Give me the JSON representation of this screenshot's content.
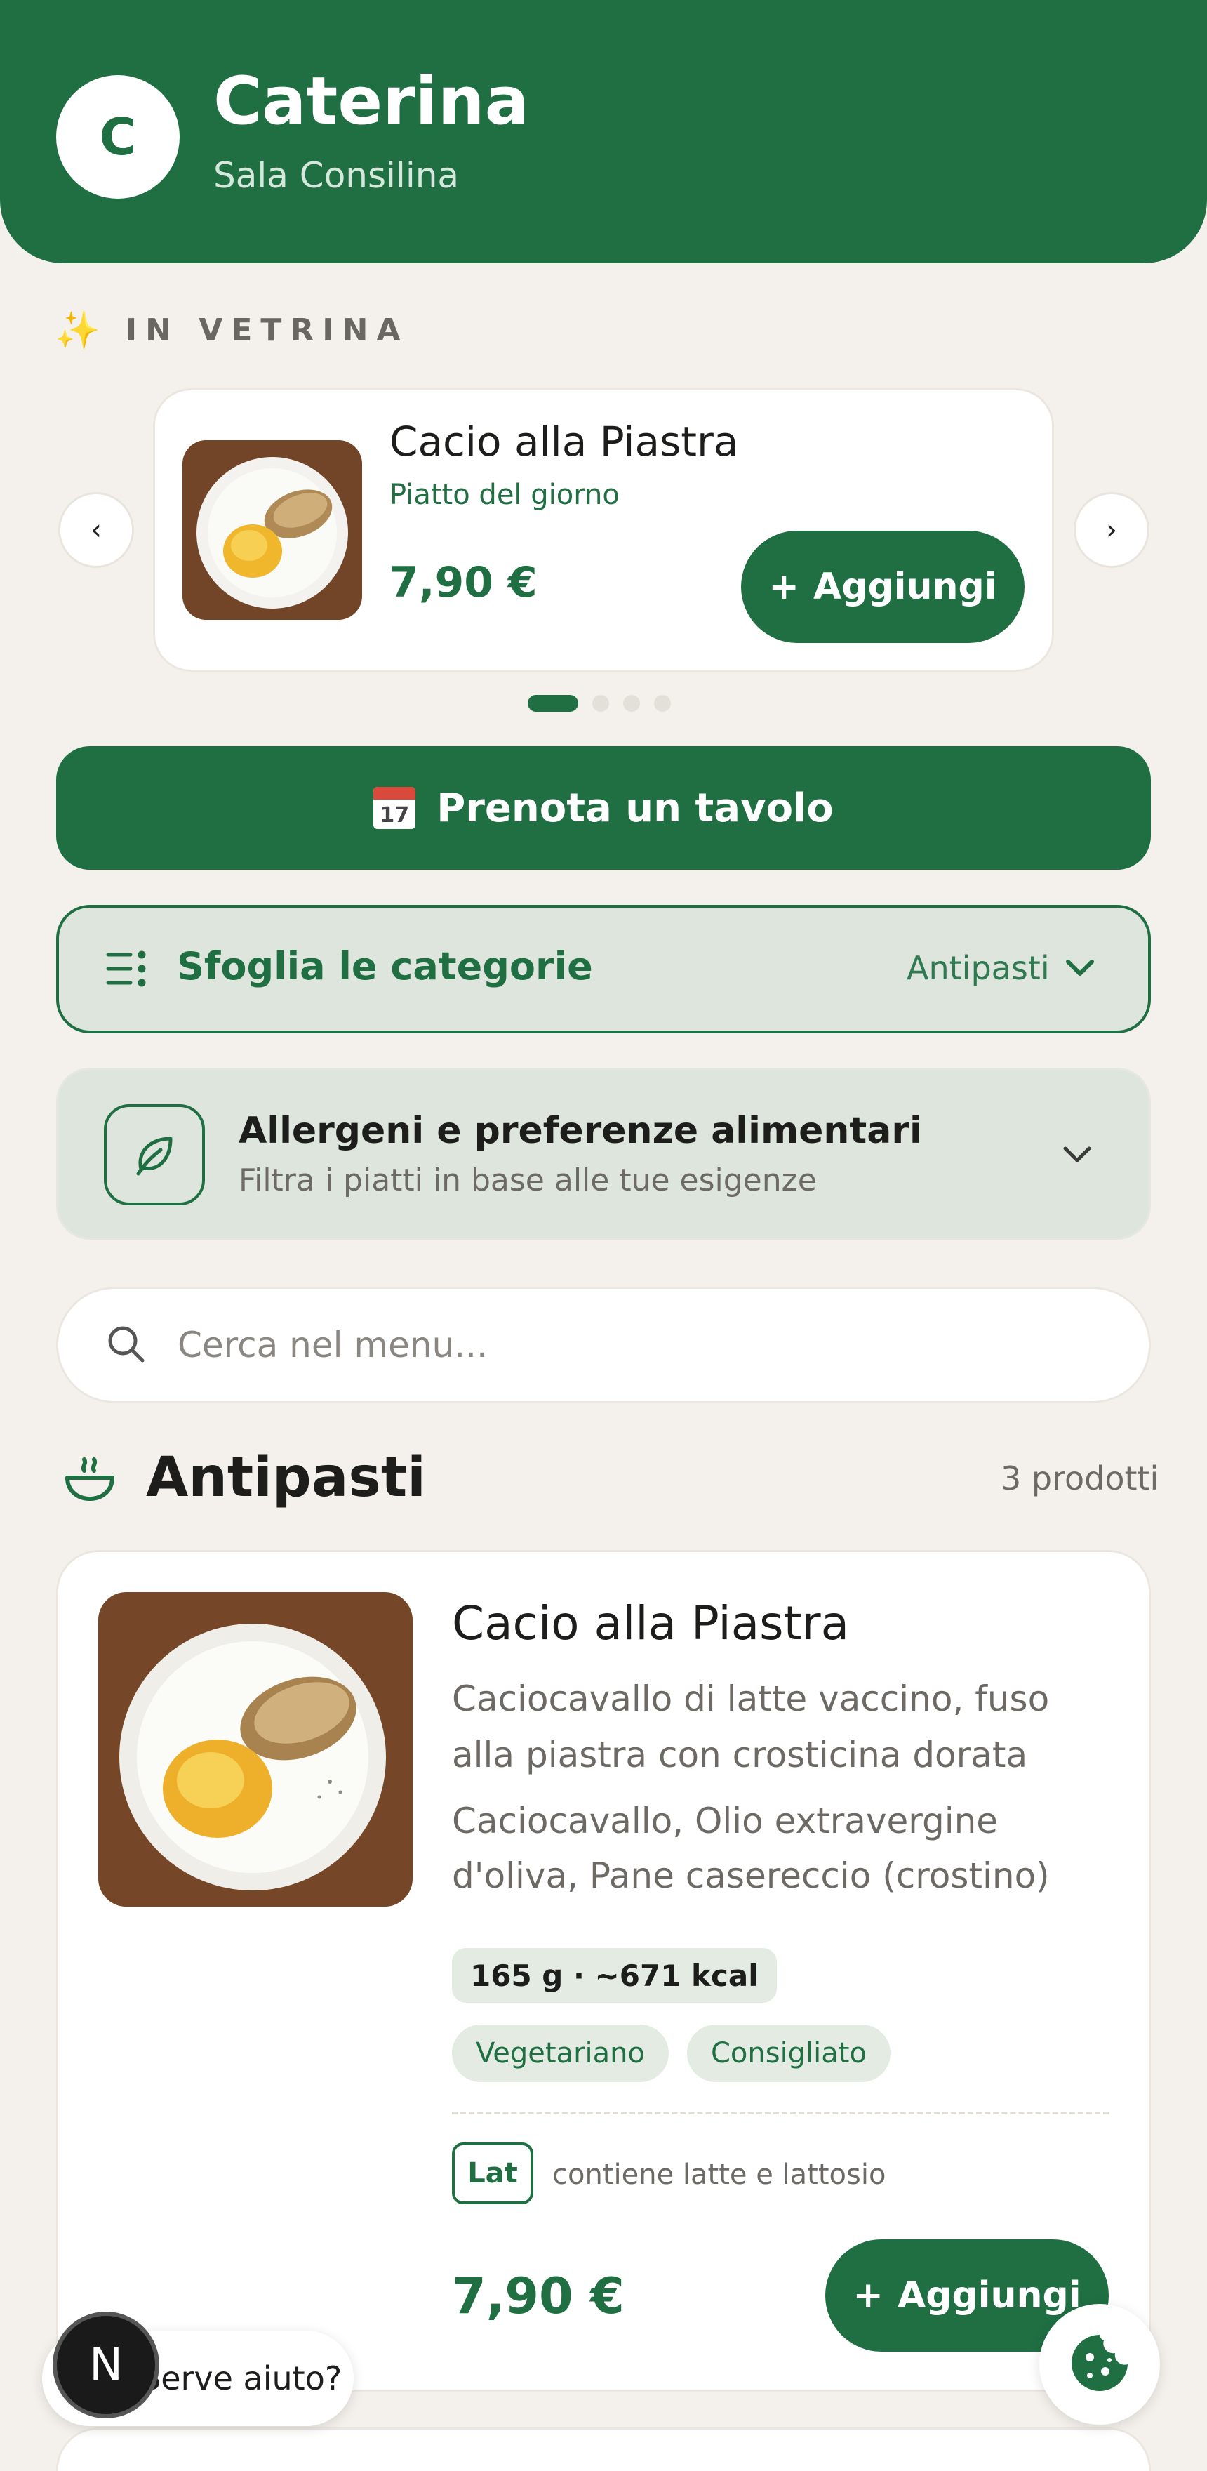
{
  "header": {
    "avatar_letter": "C",
    "title": "Caterina",
    "subtitle": "Sala Consilina"
  },
  "showcase": {
    "label": "IN VETRINA",
    "item": {
      "name": "Cacio alla Piastra",
      "tag": "Piatto del giorno",
      "price": "7,90 €",
      "add_label": "Aggiungi"
    },
    "slide_count": 4,
    "active_slide": 1
  },
  "reserve": {
    "label": "Prenota un tavolo",
    "calendar_day": "17"
  },
  "categories": {
    "label": "Sfoglia le categorie",
    "current": "Antipasti"
  },
  "allergens": {
    "title": "Allergeni e preferenze alimentari",
    "subtitle": "Filtra i piatti in base alle tue esigenze"
  },
  "search": {
    "placeholder": "Cerca nel menu..."
  },
  "section": {
    "title": "Antipasti",
    "count": "3 prodotti"
  },
  "product": {
    "name": "Cacio alla Piastra",
    "description": "Caciocavallo di latte vaccino, fuso alla piastra con crosticina dorata",
    "ingredients": "Caciocavallo, Olio extravergine d'oliva, Pane casereccio (crostino)",
    "nutrition": "165 g · ~671 kcal",
    "tags": [
      "Vegetariano",
      "Consigliato"
    ],
    "allergen_code": "Lat",
    "allergen_text": "contiene latte e lattosio",
    "price": "7,90 €",
    "add_label": "Aggiungi"
  },
  "help": {
    "label": "Serve aiuto?",
    "badge": "N"
  },
  "colors": {
    "primary": "#1f6f43",
    "background": "#f4f1ec",
    "soft_green": "#dde5dc"
  }
}
